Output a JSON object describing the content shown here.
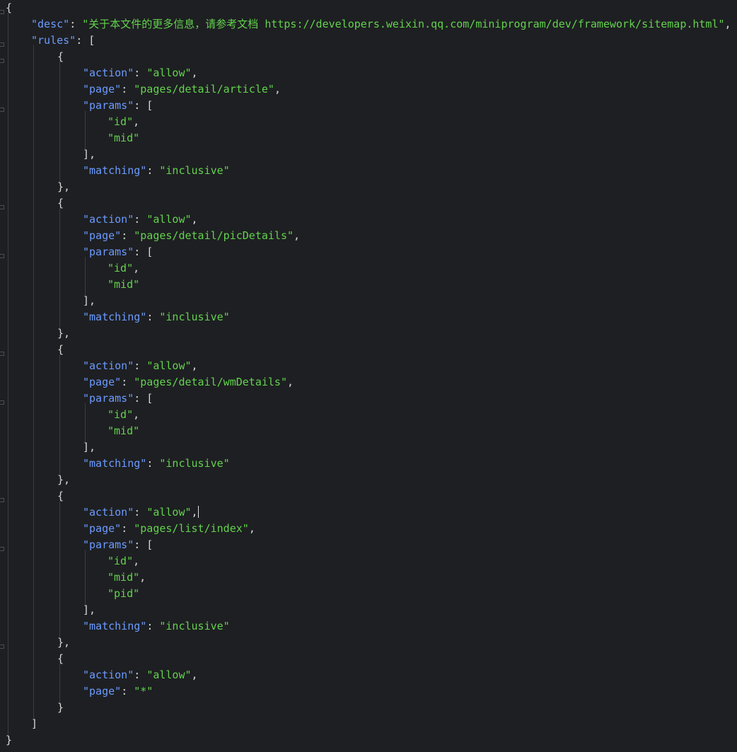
{
  "code": [
    [
      {
        "t": "p",
        "v": "{"
      }
    ],
    [
      {
        "t": "k",
        "v": "\"desc\""
      },
      {
        "t": "p",
        "v": ": "
      },
      {
        "t": "s",
        "v": "\"关于本文件的更多信息，请参考文档 https://developers.weixin.qq.com/miniprogram/dev/framework/sitemap.html\""
      },
      {
        "t": "p",
        "v": ","
      }
    ],
    [
      {
        "t": "k",
        "v": "\"rules\""
      },
      {
        "t": "p",
        "v": ": ["
      }
    ],
    [
      {
        "t": "p",
        "v": "{"
      }
    ],
    [
      {
        "t": "k",
        "v": "\"action\""
      },
      {
        "t": "p",
        "v": ": "
      },
      {
        "t": "s",
        "v": "\"allow\""
      },
      {
        "t": "p",
        "v": ","
      }
    ],
    [
      {
        "t": "k",
        "v": "\"page\""
      },
      {
        "t": "p",
        "v": ": "
      },
      {
        "t": "s",
        "v": "\"pages/detail/article\""
      },
      {
        "t": "p",
        "v": ","
      }
    ],
    [
      {
        "t": "k",
        "v": "\"params\""
      },
      {
        "t": "p",
        "v": ": ["
      }
    ],
    [
      {
        "t": "s",
        "v": "\"id\""
      },
      {
        "t": "p",
        "v": ","
      }
    ],
    [
      {
        "t": "s",
        "v": "\"mid\""
      }
    ],
    [
      {
        "t": "p",
        "v": "],"
      }
    ],
    [
      {
        "t": "k",
        "v": "\"matching\""
      },
      {
        "t": "p",
        "v": ": "
      },
      {
        "t": "s",
        "v": "\"inclusive\""
      }
    ],
    [
      {
        "t": "p",
        "v": "},"
      }
    ],
    [
      {
        "t": "p",
        "v": "{"
      }
    ],
    [
      {
        "t": "k",
        "v": "\"action\""
      },
      {
        "t": "p",
        "v": ": "
      },
      {
        "t": "s",
        "v": "\"allow\""
      },
      {
        "t": "p",
        "v": ","
      }
    ],
    [
      {
        "t": "k",
        "v": "\"page\""
      },
      {
        "t": "p",
        "v": ": "
      },
      {
        "t": "s",
        "v": "\"pages/detail/picDetails\""
      },
      {
        "t": "p",
        "v": ","
      }
    ],
    [
      {
        "t": "k",
        "v": "\"params\""
      },
      {
        "t": "p",
        "v": ": ["
      }
    ],
    [
      {
        "t": "s",
        "v": "\"id\""
      },
      {
        "t": "p",
        "v": ","
      }
    ],
    [
      {
        "t": "s",
        "v": "\"mid\""
      }
    ],
    [
      {
        "t": "p",
        "v": "],"
      }
    ],
    [
      {
        "t": "k",
        "v": "\"matching\""
      },
      {
        "t": "p",
        "v": ": "
      },
      {
        "t": "s",
        "v": "\"inclusive\""
      }
    ],
    [
      {
        "t": "p",
        "v": "},"
      }
    ],
    [
      {
        "t": "p",
        "v": "{"
      }
    ],
    [
      {
        "t": "k",
        "v": "\"action\""
      },
      {
        "t": "p",
        "v": ": "
      },
      {
        "t": "s",
        "v": "\"allow\""
      },
      {
        "t": "p",
        "v": ","
      }
    ],
    [
      {
        "t": "k",
        "v": "\"page\""
      },
      {
        "t": "p",
        "v": ": "
      },
      {
        "t": "s",
        "v": "\"pages/detail/wmDetails\""
      },
      {
        "t": "p",
        "v": ","
      }
    ],
    [
      {
        "t": "k",
        "v": "\"params\""
      },
      {
        "t": "p",
        "v": ": ["
      }
    ],
    [
      {
        "t": "s",
        "v": "\"id\""
      },
      {
        "t": "p",
        "v": ","
      }
    ],
    [
      {
        "t": "s",
        "v": "\"mid\""
      }
    ],
    [
      {
        "t": "p",
        "v": "],"
      }
    ],
    [
      {
        "t": "k",
        "v": "\"matching\""
      },
      {
        "t": "p",
        "v": ": "
      },
      {
        "t": "s",
        "v": "\"inclusive\""
      }
    ],
    [
      {
        "t": "p",
        "v": "},"
      }
    ],
    [
      {
        "t": "p",
        "v": "{"
      }
    ],
    [
      {
        "t": "k",
        "v": "\"action\""
      },
      {
        "t": "p",
        "v": ": "
      },
      {
        "t": "s",
        "v": "\"allow\""
      },
      {
        "t": "p",
        "v": ","
      }
    ],
    [
      {
        "t": "k",
        "v": "\"page\""
      },
      {
        "t": "p",
        "v": ": "
      },
      {
        "t": "s",
        "v": "\"pages/list/index\""
      },
      {
        "t": "p",
        "v": ","
      }
    ],
    [
      {
        "t": "k",
        "v": "\"params\""
      },
      {
        "t": "p",
        "v": ": ["
      }
    ],
    [
      {
        "t": "s",
        "v": "\"id\""
      },
      {
        "t": "p",
        "v": ","
      }
    ],
    [
      {
        "t": "s",
        "v": "\"mid\""
      },
      {
        "t": "p",
        "v": ","
      }
    ],
    [
      {
        "t": "s",
        "v": "\"pid\""
      }
    ],
    [
      {
        "t": "p",
        "v": "],"
      }
    ],
    [
      {
        "t": "k",
        "v": "\"matching\""
      },
      {
        "t": "p",
        "v": ": "
      },
      {
        "t": "s",
        "v": "\"inclusive\""
      }
    ],
    [
      {
        "t": "p",
        "v": "},"
      }
    ],
    [
      {
        "t": "p",
        "v": "{"
      }
    ],
    [
      {
        "t": "k",
        "v": "\"action\""
      },
      {
        "t": "p",
        "v": ": "
      },
      {
        "t": "s",
        "v": "\"allow\""
      },
      {
        "t": "p",
        "v": ","
      }
    ],
    [
      {
        "t": "k",
        "v": "\"page\""
      },
      {
        "t": "p",
        "v": ": "
      },
      {
        "t": "s",
        "v": "\"*\""
      }
    ],
    [
      {
        "t": "p",
        "v": "}"
      }
    ],
    [
      {
        "t": "p",
        "v": "]"
      }
    ],
    [
      {
        "t": "p",
        "v": "}"
      }
    ]
  ],
  "colors": {
    "background": "#1e1f22",
    "key": "#6b9bff",
    "string": "#63d24e",
    "punctuation": "#d7d7d7"
  }
}
